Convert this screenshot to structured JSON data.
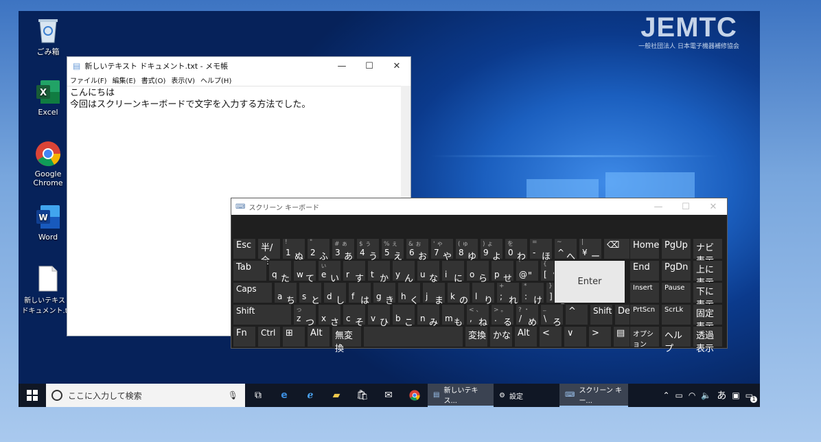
{
  "watermark": {
    "logo": "JEMTC",
    "subtitle": "一般社団法人 日本電子機器補修協会"
  },
  "desktop_icons": [
    {
      "label": "ごみ箱",
      "icon": "recycle-bin-icon"
    },
    {
      "label": "Excel",
      "icon": "excel-icon"
    },
    {
      "label": "Google Chrome",
      "icon": "chrome-icon"
    },
    {
      "label": "Word",
      "icon": "word-icon"
    },
    {
      "label": "新しいテキスト ドキュメント.txt",
      "icon": "text-file-icon"
    }
  ],
  "notepad": {
    "title": "新しいテキスト ドキュメント.txt - メモ帳",
    "menu": [
      "ファイル(F)",
      "編集(E)",
      "書式(O)",
      "表示(V)",
      "ヘルプ(H)"
    ],
    "lines": [
      "こんにちは",
      "今回はスクリーンキーボードで文字を入力する方法でした。"
    ]
  },
  "window_buttons": {
    "minimize": "—",
    "maximize": "☐",
    "close": "✕"
  },
  "osk": {
    "title": "スクリーン キーボード",
    "rows": [
      [
        {
          "s": "",
          "m": "Esc",
          "w": 34
        },
        {
          "s": "",
          "m": "半/全",
          "w": 34
        },
        {
          "s": "!",
          "a": "1",
          "b": "ぬ",
          "w": 34
        },
        {
          "s": "\"",
          "a": "2",
          "b": "ふ",
          "w": 34
        },
        {
          "s": "# ぁ",
          "a": "3",
          "b": "あ",
          "w": 34
        },
        {
          "s": "$ ぅ",
          "a": "4",
          "b": "う",
          "w": 34
        },
        {
          "s": "% ぇ",
          "a": "5",
          "b": "え",
          "w": 34
        },
        {
          "s": "& ぉ",
          "a": "6",
          "b": "お",
          "w": 34
        },
        {
          "s": "' ゃ",
          "a": "7",
          "b": "や",
          "w": 34
        },
        {
          "s": "( ゅ",
          "a": "8",
          "b": "ゆ",
          "w": 34
        },
        {
          "s": ") ょ",
          "a": "9",
          "b": "よ",
          "w": 34
        },
        {
          "s": "を",
          "a": "0",
          "b": "わ",
          "w": 34
        },
        {
          "s": "=",
          "a": "-",
          "b": "ほ",
          "w": 34
        },
        {
          "s": "~",
          "a": "^",
          "b": "へ",
          "w": 34
        },
        {
          "s": "|",
          "a": "¥",
          "b": "ー",
          "w": 34
        },
        {
          "s": "",
          "m": "⌫",
          "w": 60
        }
      ],
      [
        {
          "s": "",
          "m": "Tab",
          "w": 50
        },
        {
          "s": "",
          "a": "q",
          "b": "た",
          "w": 34
        },
        {
          "s": "",
          "a": "w",
          "b": "て",
          "w": 34
        },
        {
          "s": "ぃ",
          "a": "e",
          "b": "い",
          "w": 34
        },
        {
          "s": "",
          "a": "r",
          "b": "す",
          "w": 34
        },
        {
          "s": "",
          "a": "t",
          "b": "か",
          "w": 34
        },
        {
          "s": "",
          "a": "y",
          "b": "ん",
          "w": 34
        },
        {
          "s": "",
          "a": "u",
          "b": "な",
          "w": 34
        },
        {
          "s": "",
          "a": "i",
          "b": "に",
          "w": 34
        },
        {
          "s": "",
          "a": "o",
          "b": "ら",
          "w": 34
        },
        {
          "s": "",
          "a": "p",
          "b": "せ",
          "w": 34
        },
        {
          "s": "`",
          "a": "@",
          "b": "\"",
          "w": 34
        },
        {
          "s": "{",
          "a": "[",
          "b": "°",
          "w": 34
        }
      ],
      [
        {
          "s": "",
          "m": "Caps",
          "w": 58
        },
        {
          "s": "",
          "a": "a",
          "b": "ち",
          "w": 34
        },
        {
          "s": "",
          "a": "s",
          "b": "と",
          "w": 34
        },
        {
          "s": "",
          "a": "d",
          "b": "し",
          "w": 34
        },
        {
          "s": "",
          "a": "f",
          "b": "は",
          "w": 34
        },
        {
          "s": "",
          "a": "g",
          "b": "き",
          "w": 34
        },
        {
          "s": "",
          "a": "h",
          "b": "く",
          "w": 34
        },
        {
          "s": "",
          "a": "j",
          "b": "ま",
          "w": 34
        },
        {
          "s": "",
          "a": "k",
          "b": "の",
          "w": 34
        },
        {
          "s": "",
          "a": "l",
          "b": "り",
          "w": 34
        },
        {
          "s": "+",
          "a": ";",
          "b": "れ",
          "w": 34
        },
        {
          "s": "*",
          "a": ":",
          "b": "け",
          "w": 34
        },
        {
          "s": "}",
          "a": "]",
          "b": "む",
          "w": 34
        }
      ],
      [
        {
          "s": "",
          "m": "Shift",
          "w": 86
        },
        {
          "s": "っ",
          "a": "z",
          "b": "つ",
          "w": 34
        },
        {
          "s": "",
          "a": "x",
          "b": "さ",
          "w": 34
        },
        {
          "s": "",
          "a": "c",
          "b": "そ",
          "w": 34
        },
        {
          "s": "",
          "a": "v",
          "b": "ひ",
          "w": 34
        },
        {
          "s": "",
          "a": "b",
          "b": "こ",
          "w": 34
        },
        {
          "s": "",
          "a": "n",
          "b": "み",
          "w": 34
        },
        {
          "s": "",
          "a": "m",
          "b": "も",
          "w": 34
        },
        {
          "s": "< 、",
          "a": ",",
          "b": "ね",
          "w": 34
        },
        {
          "s": "> 。",
          "a": ".",
          "b": "る",
          "w": 34
        },
        {
          "s": "? ・",
          "a": "/",
          "b": "め",
          "w": 34
        },
        {
          "s": "_",
          "a": "\\",
          "b": "ろ",
          "w": 34
        },
        {
          "s": "",
          "m": "^",
          "w": 34
        },
        {
          "s": "",
          "m": "Shift",
          "w": 34
        },
        {
          "s": "",
          "m": "Del",
          "w": 34
        }
      ],
      [
        {
          "s": "",
          "m": "Fn",
          "w": 34
        },
        {
          "s": "",
          "m": "Ctrl",
          "w": 34
        },
        {
          "s": "",
          "m": "⊞",
          "w": 34
        },
        {
          "s": "",
          "m": "Alt",
          "w": 34
        },
        {
          "s": "",
          "m": "無変換",
          "w": 44
        },
        {
          "s": "",
          "m": "",
          "w": 146
        },
        {
          "s": "",
          "m": "変換",
          "w": 34
        },
        {
          "s": "",
          "m": "かな",
          "w": 34
        },
        {
          "s": "",
          "m": "Alt",
          "w": 34
        },
        {
          "s": "",
          "m": "<",
          "w": 34
        },
        {
          "s": "",
          "m": "∨",
          "w": 34
        },
        {
          "s": "",
          "m": ">",
          "w": 34
        },
        {
          "s": "",
          "m": "▤",
          "w": 34
        }
      ]
    ],
    "enter": "Enter",
    "side": [
      [
        "Home",
        "PgUp",
        "ナビ表示"
      ],
      [
        "End",
        "PgDn",
        "上に表示"
      ],
      [
        "Insert",
        "Pause",
        "下に表示"
      ],
      [
        "PrtScn",
        "ScrLk",
        "固定表示"
      ],
      [
        "オプション",
        "ヘルプ",
        "透過表示"
      ]
    ]
  },
  "taskbar": {
    "search_placeholder": "ここに入力して検索",
    "apps": [
      {
        "label": "新しいテキス...",
        "icon": "notepad-icon"
      },
      {
        "label": "設定",
        "icon": "gear-icon"
      },
      {
        "label": "スクリーン キー...",
        "icon": "keyboard-icon"
      }
    ],
    "ime": "あ",
    "notifications": "1"
  }
}
